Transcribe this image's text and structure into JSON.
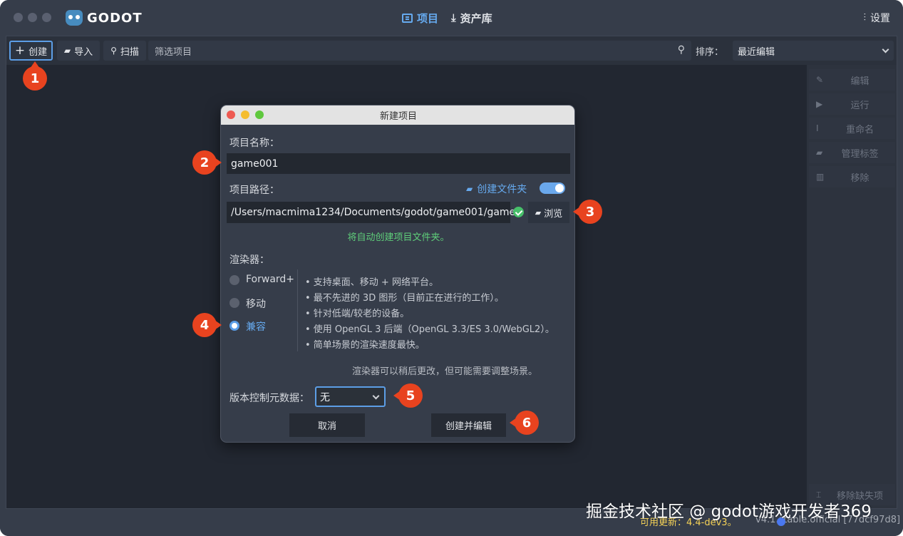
{
  "app": {
    "logo_text": "GODOT",
    "tabs": [
      {
        "label": "项目",
        "icon": "project-list-icon"
      },
      {
        "label": "资产库",
        "icon": "download-icon"
      }
    ],
    "settings_label": "设置"
  },
  "toolbar": {
    "create_label": "创建",
    "import_label": "导入",
    "scan_label": "扫描",
    "filter_placeholder": "筛选项目",
    "sort_label": "排序：",
    "sort_value": "最近编辑"
  },
  "sidebar": {
    "items": [
      {
        "label": "编辑",
        "icon": "edit-icon"
      },
      {
        "label": "运行",
        "icon": "play-icon"
      },
      {
        "label": "重命名",
        "icon": "rename-icon"
      },
      {
        "label": "管理标签",
        "icon": "tag-icon"
      },
      {
        "label": "移除",
        "icon": "trash-icon"
      }
    ],
    "remove_missing_label": "移除缺失项"
  },
  "status": {
    "update_text": "可用更新：4.4-dev3。",
    "version_text": "v4.1.stable.official [77dcf97d8]"
  },
  "watermark": "掘金技术社区 @ godot游戏开发者369",
  "dialog": {
    "title": "新建项目",
    "project_name_label": "项目名称：",
    "project_name_value": "game001",
    "project_path_label": "项目路径：",
    "create_folder_label": "创建文件夹",
    "create_folder_on": true,
    "project_path_value": "/Users/macmima1234/Documents/godot/game001/game",
    "browse_label": "浏览",
    "auto_create_note": "将自动创建项目文件夹。",
    "renderer_label": "渲染器：",
    "renderers": [
      {
        "label": "Forward+",
        "selected": false
      },
      {
        "label": "移动",
        "selected": false
      },
      {
        "label": "兼容",
        "selected": true
      }
    ],
    "renderer_bullets": [
      "•  支持桌面、移动 + 网络平台。",
      "•  最不先进的 3D 图形（目前正在进行的工作）。",
      "•  针对低端/较老的设备。",
      "•  使用 OpenGL 3 后端（OpenGL 3.3/ES 3.0/WebGL2）。",
      "•  简单场景的渲染速度最快。"
    ],
    "renderer_note": "渲染器可以稍后更改，但可能需要调整场景。",
    "vcs_label": "版本控制元数据：",
    "vcs_value": "无",
    "cancel_label": "取消",
    "create_edit_label": "创建并编辑"
  },
  "markers": [
    "1",
    "2",
    "3",
    "4",
    "5",
    "6"
  ],
  "colors": {
    "accent": "#66aaef",
    "marker": "#e8431f",
    "success": "#5fce7a",
    "update": "#f5d257"
  }
}
